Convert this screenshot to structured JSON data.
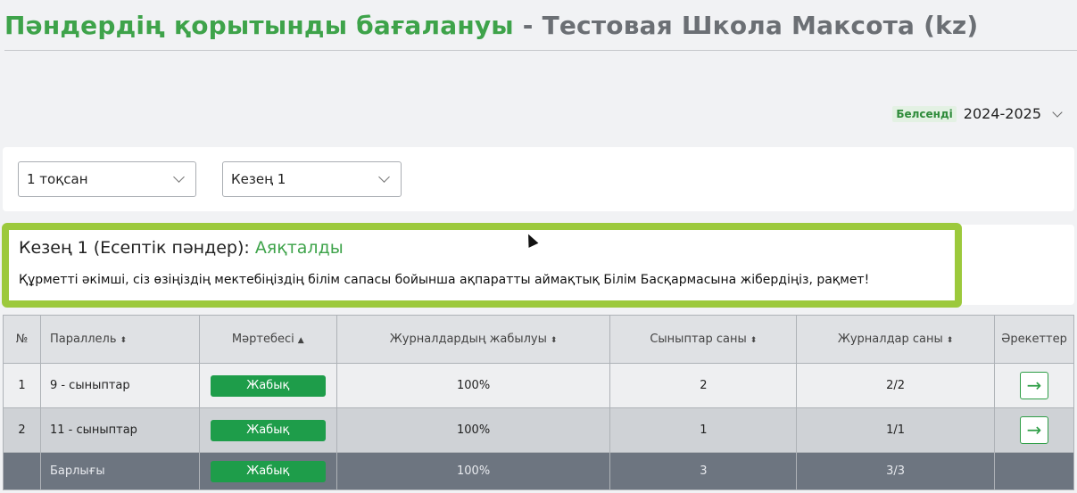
{
  "header": {
    "title_main": "Пәндердің қорытынды бағалануы",
    "title_sep": " - ",
    "school": "Тестовая Школа Максота (kz)"
  },
  "year_selector": {
    "status": "Белсенді",
    "value": "2024-2025"
  },
  "filters": {
    "quarter": "1 тоқсан",
    "period": "Кезең 1"
  },
  "info": {
    "heading": "Кезең 1 (Есептік пәндер): ",
    "status": "Аяқталды",
    "message": "Құрметті әкімші, сіз өзіңіздің мектебіңіздің білім сапасы бойынша ақпаратты аймақтық Білім Басқармасына жібердіңіз, рақмет!"
  },
  "table": {
    "headers": {
      "num": "№",
      "parallel": "Параллель",
      "status": "Мәртебесі",
      "closing": "Журналдардың жабылуы",
      "classes": "Сыныптар саны",
      "journals": "Журналдар саны",
      "actions": "Әрекеттер"
    },
    "sort_icons": {
      "both": "⬍",
      "up": "▲"
    },
    "rows": [
      {
        "num": "1",
        "parallel": "9 - сыныптар",
        "status": "Жабық",
        "closing": "100%",
        "classes": "2",
        "journals": "2/2",
        "action_icon": "→"
      },
      {
        "num": "2",
        "parallel": "11 - сыныптар",
        "status": "Жабық",
        "closing": "100%",
        "classes": "1",
        "journals": "1/1",
        "action_icon": "→"
      }
    ],
    "total": {
      "label": "Барлығы",
      "status": "Жабық",
      "closing": "100%",
      "classes": "3",
      "journals": "3/3"
    }
  },
  "colors": {
    "title_green": "#3ea34a",
    "highlight_border": "#9cc93c",
    "badge_green": "#1e9d4a",
    "total_row_bg": "#6d7580"
  }
}
